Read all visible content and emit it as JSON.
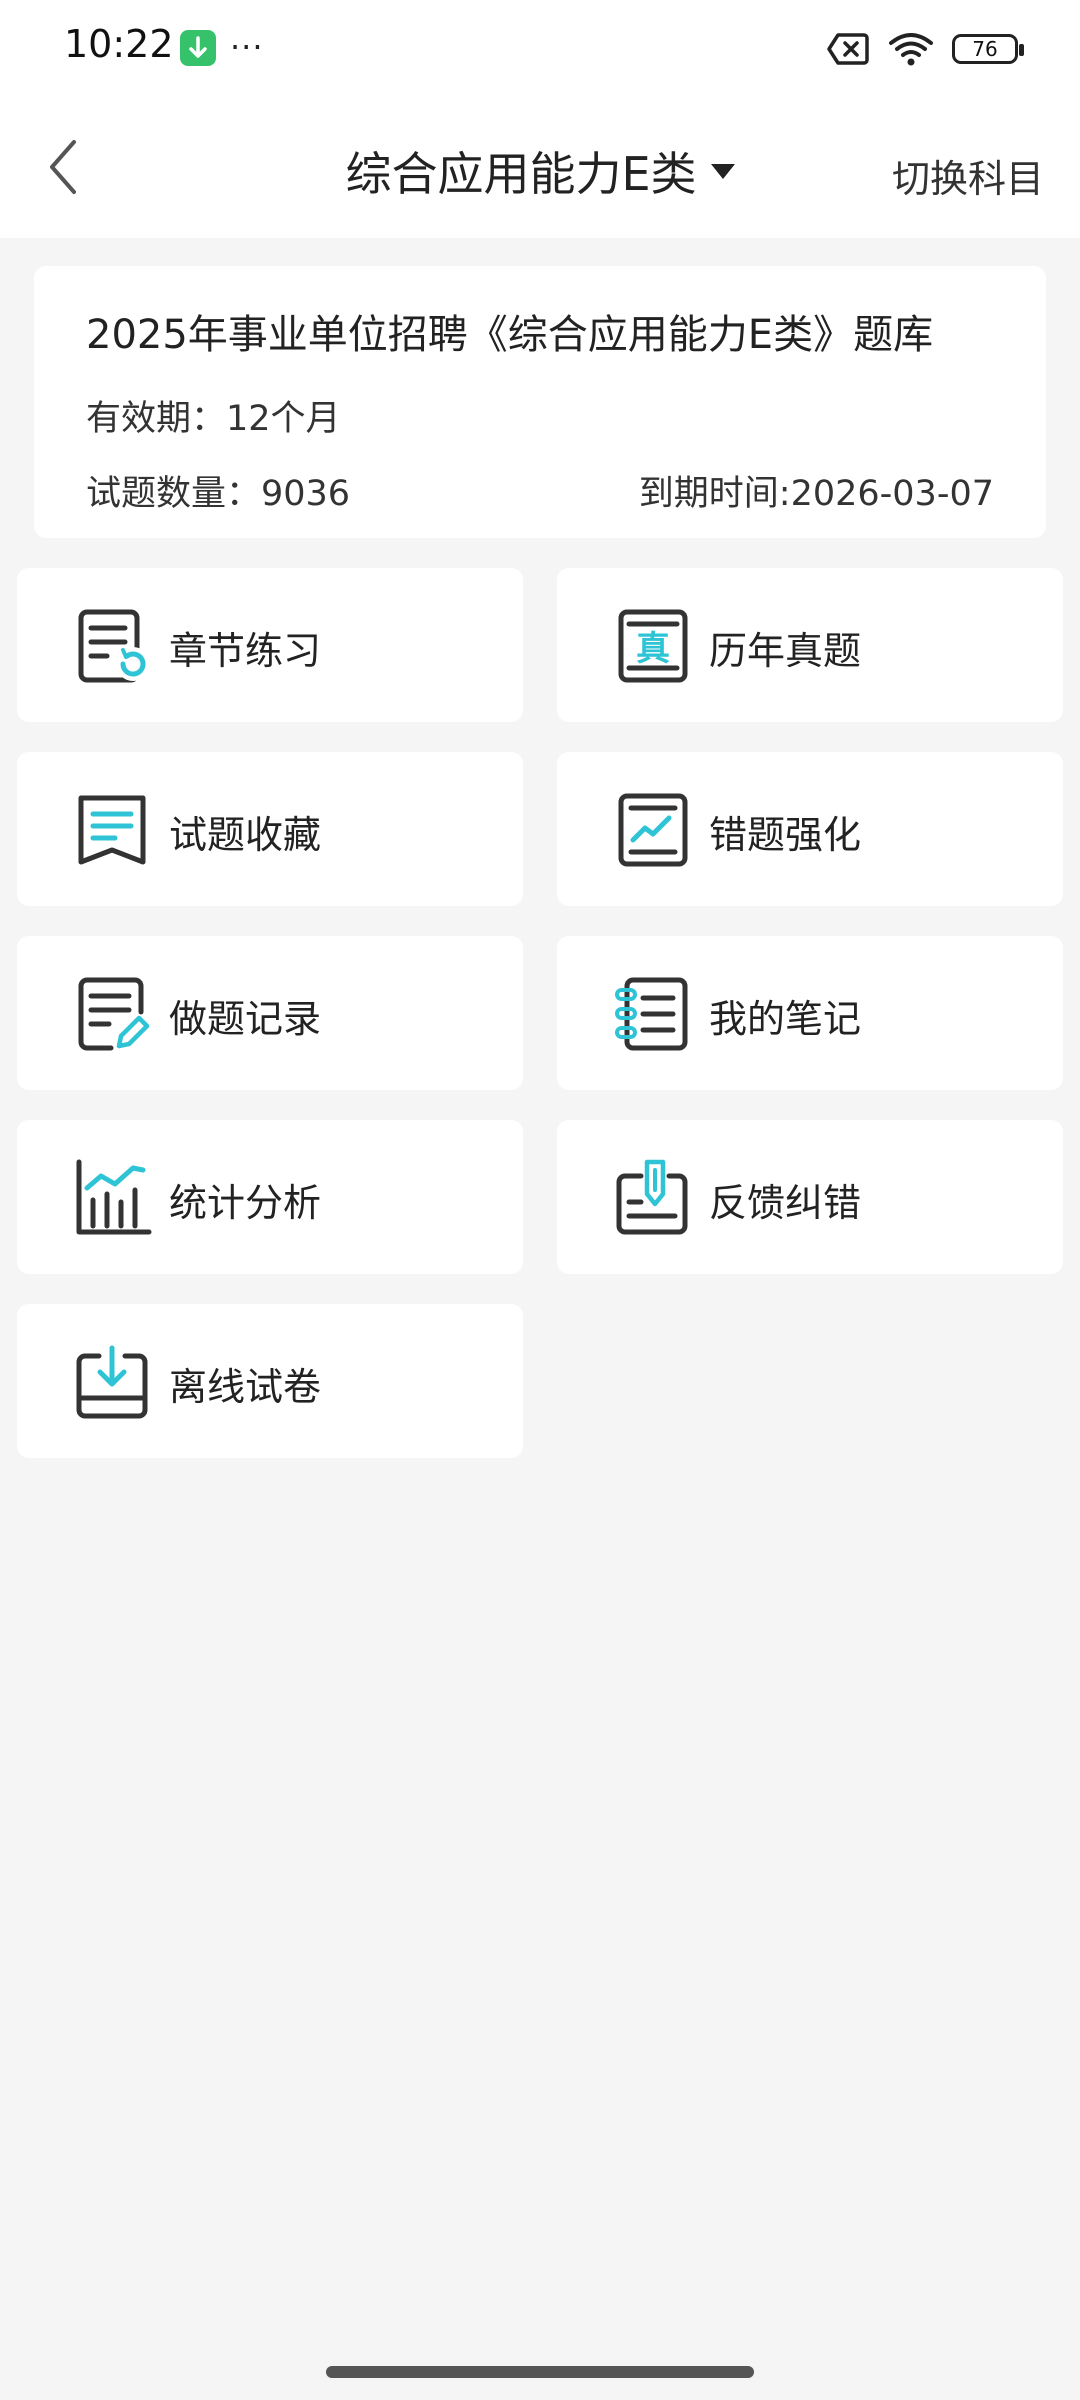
{
  "status_bar": {
    "time": "10:22",
    "more": "···",
    "battery": "76",
    "icons": [
      "download-icon",
      "no-sim-icon",
      "wifi-icon",
      "battery-icon"
    ]
  },
  "header": {
    "title": "综合应用能力E类",
    "switch_label": "切换科目"
  },
  "info": {
    "title": "2025年事业单位招聘《综合应用能力E类》题库",
    "validity": "有效期：12个月",
    "question_count": "试题数量：9036",
    "expire": "到期时间:2026-03-07"
  },
  "menu": [
    {
      "label": "章节练习",
      "icon": "chapter-practice-icon"
    },
    {
      "label": "历年真题",
      "icon": "past-exams-icon"
    },
    {
      "label": "试题收藏",
      "icon": "favorites-icon"
    },
    {
      "label": "错题强化",
      "icon": "mistakes-icon"
    },
    {
      "label": "做题记录",
      "icon": "records-icon"
    },
    {
      "label": "我的笔记",
      "icon": "notes-icon"
    },
    {
      "label": "统计分析",
      "icon": "statistics-icon"
    },
    {
      "label": "反馈纠错",
      "icon": "feedback-icon"
    },
    {
      "label": "离线试卷",
      "icon": "offline-papers-icon"
    }
  ],
  "colors": {
    "accent": "#2ec4d6",
    "icon_dark": "#333333",
    "background": "#f5f5f5",
    "card": "#ffffff"
  }
}
